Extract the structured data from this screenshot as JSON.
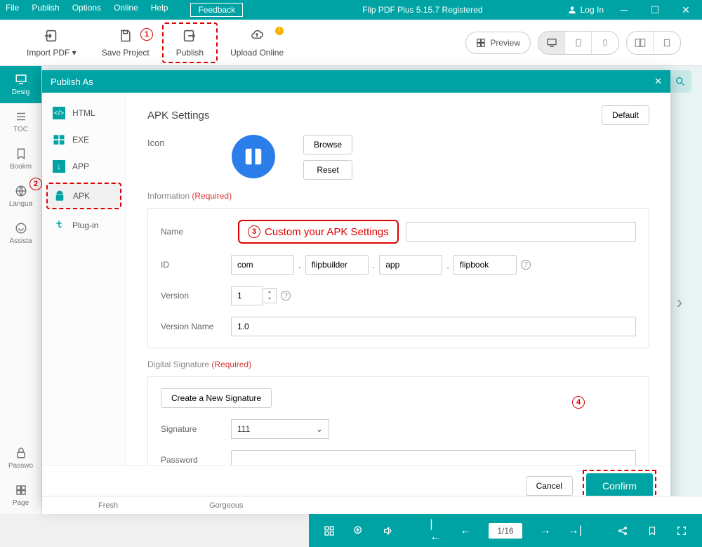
{
  "titlebar": {
    "menu": [
      "File",
      "Publish",
      "Options",
      "Online",
      "Help"
    ],
    "feedback": "Feedback",
    "title": "Flip PDF Plus 5.15.7 Registered",
    "login": "Log In"
  },
  "toolbar": {
    "import_pdf": "Import PDF",
    "save_project": "Save Project",
    "publish": "Publish",
    "upload_online": "Upload Online",
    "preview": "Preview"
  },
  "left_tabs": {
    "design": "Desig",
    "toc": "TOC",
    "bookmark": "Bookm",
    "language": "Langua",
    "assistant": "Assista",
    "password": "Passwo",
    "page": "Page"
  },
  "modal": {
    "title": "Publish As",
    "sidebar": {
      "html": "HTML",
      "exe": "EXE",
      "app": "APP",
      "apk": "APK",
      "plugin": "Plug-in"
    },
    "heading": "APK Settings",
    "default_btn": "Default",
    "icon_label": "Icon",
    "browse": "Browse",
    "reset": "Reset",
    "information": "Information",
    "required": "(Required)",
    "name_label": "Name",
    "id_label": "ID",
    "id1": "com",
    "id2": "flipbuilder",
    "id3": "app",
    "id4": "flipbook",
    "version_label": "Version",
    "version": "1",
    "version_name_label": "Version Name",
    "version_name": "1.0",
    "digital_sig": "Digital Signature",
    "create_sig": "Create a New Signature",
    "signature_label": "Signature",
    "signature_value": "111",
    "password_label": "Password",
    "cancel": "Cancel",
    "confirm": "Confirm",
    "annotation": "Custom your APK Settings"
  },
  "styles": {
    "fresh": "Fresh",
    "gorgeous": "Gorgeous"
  },
  "status": {
    "page": "1/16"
  },
  "annotations": {
    "a1": "1",
    "a2": "2",
    "a3": "3",
    "a4": "4"
  }
}
